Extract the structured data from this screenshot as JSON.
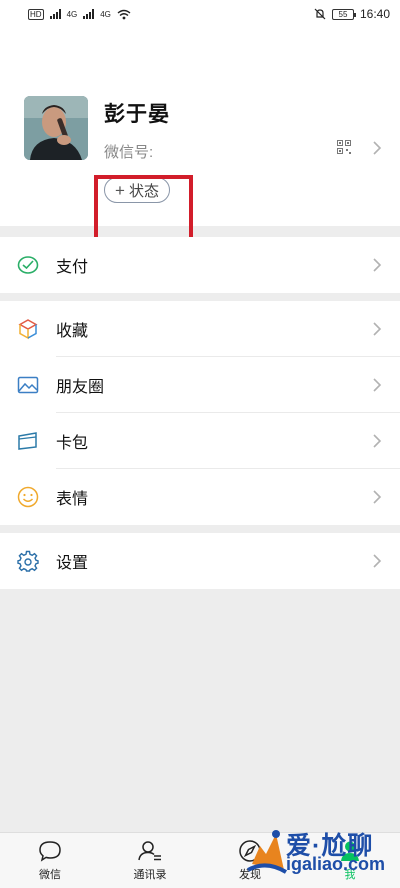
{
  "statusbar": {
    "network_left": "4G",
    "network_right": "4G",
    "battery": "55",
    "time": "16:40"
  },
  "profile": {
    "name": "彭于晏",
    "wechat_id_label": "微信号:",
    "status_plus": "+",
    "status_label": "状态"
  },
  "menu": {
    "pay": "支付",
    "favorites": "收藏",
    "moments": "朋友圈",
    "cards": "卡包",
    "stickers": "表情",
    "settings": "设置"
  },
  "tabs": {
    "chats": "微信",
    "contacts": "通讯录",
    "discover": "发现",
    "me": "我"
  },
  "watermark": {
    "line1": "爱·尬聊",
    "line2": "igaliao.com"
  },
  "colors": {
    "accent": "#07c160",
    "highlight": "#d21d2a",
    "watermark": "#1e4ea8"
  }
}
